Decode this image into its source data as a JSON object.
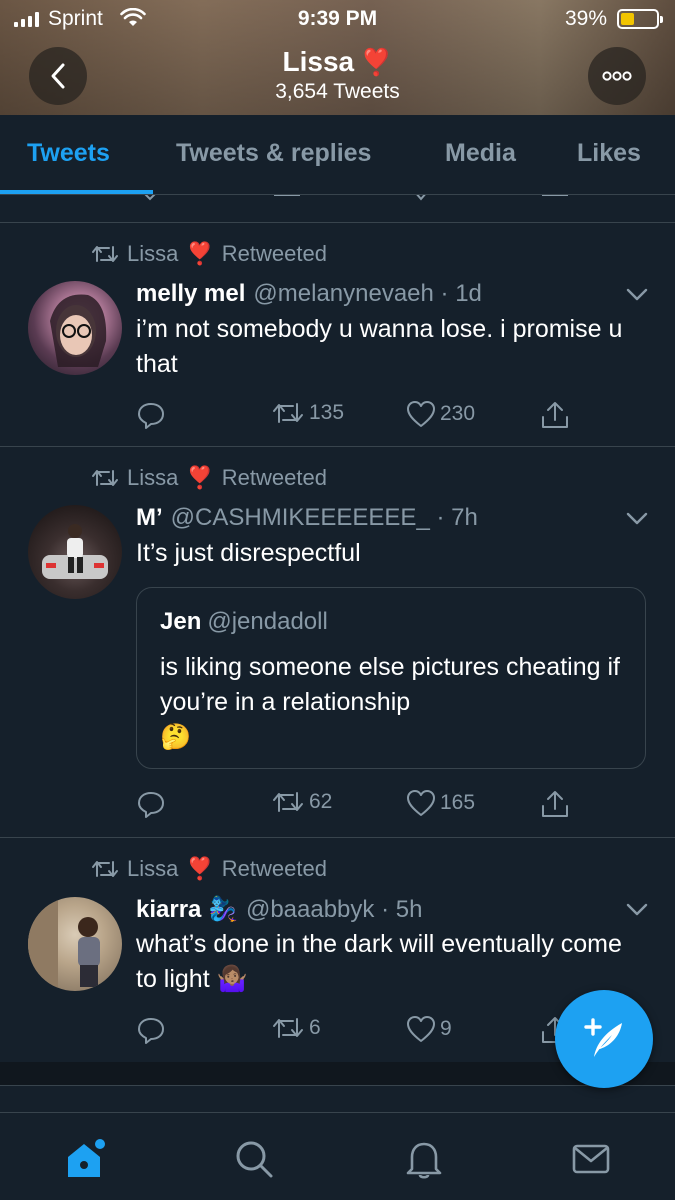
{
  "status_bar": {
    "carrier": "Sprint",
    "time": "9:39 PM",
    "battery_percent": "39%",
    "battery_level": 0.39,
    "battery_color": "#f2c400"
  },
  "header": {
    "back_icon": "chevron-left-icon",
    "name": "Lissa",
    "name_emoji": "❣️",
    "tweet_count": "3,654 Tweets",
    "more_icon": "more-icon"
  },
  "tabs": [
    {
      "label": "Tweets",
      "active": true
    },
    {
      "label": "Tweets & replies",
      "active": false
    },
    {
      "label": "Media",
      "active": false
    },
    {
      "label": "Likes",
      "active": false
    }
  ],
  "accent_color": "#1da1f2",
  "tweets": [
    {
      "retweeted_by": "Lissa",
      "retweeted_by_emoji": "❣️",
      "retweet_label": "Retweeted",
      "name": "melly mel",
      "handle_time": "@melanynevaeh · 1d",
      "text": "i’m not somebody u wanna lose. i promise u that",
      "replies": "",
      "retweets": "135",
      "likes": "230"
    },
    {
      "retweeted_by": "Lissa",
      "retweeted_by_emoji": "❣️",
      "retweet_label": "Retweeted",
      "name": "M’",
      "handle_time": "@CASHMIKEEEEEEE_ · 7h",
      "text": "It’s just disrespectful",
      "quote": {
        "name": "Jen",
        "handle": "@jendadoll",
        "text": "is liking someone else pictures cheating if you’re in a relationship",
        "emoji": "🤔"
      },
      "replies": "",
      "retweets": "62",
      "likes": "165"
    },
    {
      "retweeted_by": "Lissa",
      "retweeted_by_emoji": "❣️",
      "retweet_label": "Retweeted",
      "name": "kiarra",
      "name_emoji": "🧞‍♀️",
      "handle_time": "@baaabbyk · 5h",
      "text": "what’s done in the dark will eventually come to light",
      "text_emoji": "🤷🏽‍♀️",
      "replies": "",
      "retweets": "6",
      "likes": "9"
    }
  ],
  "bottom_nav": [
    {
      "icon": "home-icon",
      "active": true
    },
    {
      "icon": "search-icon",
      "active": false
    },
    {
      "icon": "bell-icon",
      "active": false
    },
    {
      "icon": "mail-icon",
      "active": false
    }
  ],
  "compose_icon": "compose-tweet-icon"
}
